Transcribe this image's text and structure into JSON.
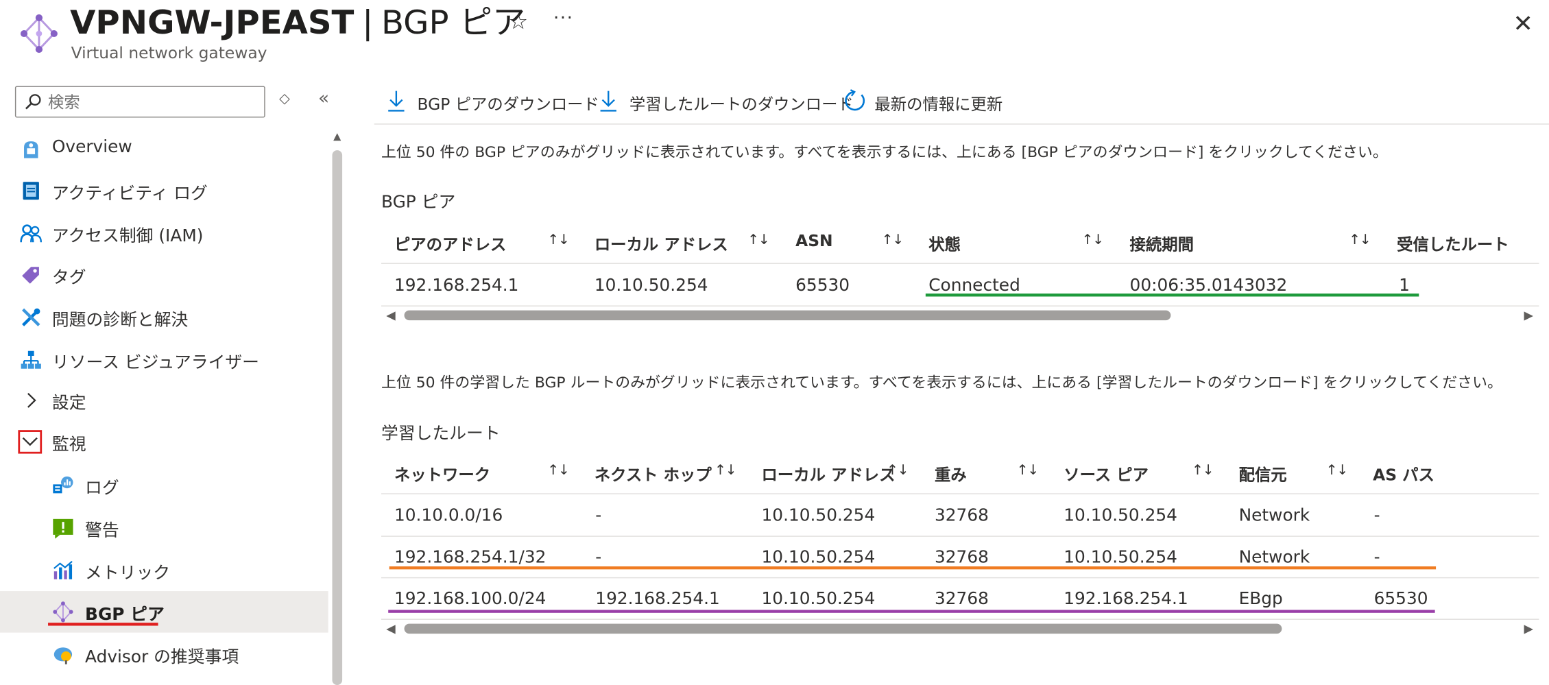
{
  "header": {
    "resource_name": "VPNGW-JPEAST",
    "separator": "|",
    "page_name": "BGP ピア",
    "subtitle": "Virtual network gateway",
    "favorite_icon": "☆",
    "more_icon": "···",
    "close_icon": "✕"
  },
  "sidebar": {
    "search_placeholder": "検索",
    "sort_icon": "◇",
    "collapse_icon": "«",
    "items": [
      {
        "label": "Overview",
        "icon": "overview-icon"
      },
      {
        "label": "アクティビティ ログ",
        "icon": "activity-log-icon"
      },
      {
        "label": "アクセス制御 (IAM)",
        "icon": "iam-icon"
      },
      {
        "label": "タグ",
        "icon": "tag-icon"
      },
      {
        "label": "問題の診断と解決",
        "icon": "diagnose-icon"
      },
      {
        "label": "リソース ビジュアライザー",
        "icon": "resource-visualizer-icon"
      },
      {
        "label": "設定",
        "icon": "chevron-right-icon"
      },
      {
        "label": "監視",
        "icon": "chevron-down-icon"
      },
      {
        "label": "ログ",
        "icon": "logs-icon"
      },
      {
        "label": "警告",
        "icon": "alerts-icon"
      },
      {
        "label": "メトリック",
        "icon": "metrics-icon"
      },
      {
        "label": "BGP ピア",
        "icon": "bgp-peers-icon",
        "active": true
      },
      {
        "label": "Advisor の推奨事項",
        "icon": "advisor-icon"
      }
    ]
  },
  "toolbar": {
    "download_bgp_peers": "BGP ピアのダウンロード",
    "download_learned_routes": "学習したルートのダウンロード",
    "refresh": "最新の情報に更新"
  },
  "peers_section": {
    "info": "上位 50 件の BGP ピアのみがグリッドに表示されています。すべてを表示するには、上にある [BGP ピアのダウンロード] をクリックしてください。",
    "title": "BGP ピア",
    "columns": [
      "ピアのアドレス",
      "ローカル アドレス",
      "ASN",
      "状態",
      "接続期間",
      "受信したルート"
    ],
    "sort_icon": "↑↓",
    "rows": [
      [
        "192.168.254.1",
        "10.10.50.254",
        "65530",
        "Connected",
        "00:06:35.0143032",
        "1"
      ]
    ],
    "scroll_fraction": 0.69
  },
  "routes_section": {
    "info": "上位 50 件の学習した BGP ルートのみがグリッドに表示されています。すべてを表示するには、上にある [学習したルートのダウンロード] をクリックしてください。",
    "title": "学習したルート",
    "columns": [
      "ネットワーク",
      "ネクスト ホップ",
      "ローカル アドレス",
      "重み",
      "ソース ピア",
      "配信元",
      "AS パス"
    ],
    "sort_icon": "↑↓",
    "rows": [
      [
        "10.10.0.0/16",
        "-",
        "10.10.50.254",
        "32768",
        "10.10.50.254",
        "Network",
        "-"
      ],
      [
        "192.168.254.1/32",
        "-",
        "10.10.50.254",
        "32768",
        "10.10.50.254",
        "Network",
        "-"
      ],
      [
        "192.168.100.0/24",
        "192.168.254.1",
        "10.10.50.254",
        "32768",
        "192.168.254.1",
        "EBgp",
        "65530"
      ]
    ],
    "scroll_fraction": 0.79
  },
  "colors": {
    "accent": "#0078d4",
    "highlight_green": "#1e9a3c",
    "highlight_orange": "#f07c22",
    "highlight_purple": "#9a3ea8",
    "highlight_red": "#e01f1f",
    "active_bg": "#edebe9"
  }
}
